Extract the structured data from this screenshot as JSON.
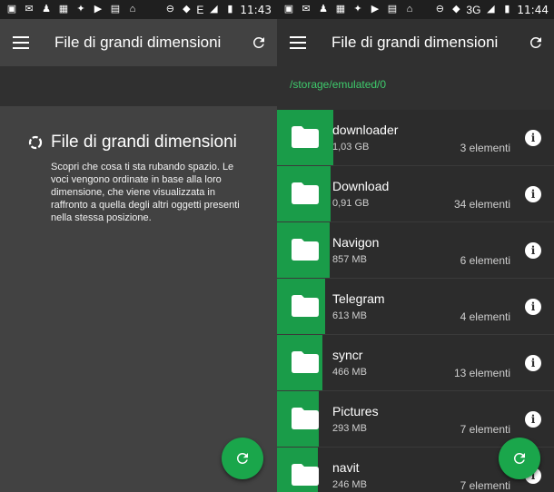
{
  "left": {
    "status": {
      "time": "11:43",
      "network": "E"
    },
    "appbar": {
      "title": "File di grandi dimensioni"
    },
    "feature": {
      "title": "File di grandi dimensioni",
      "description": "Scopri che cosa ti sta rubando spazio. Le voci vengono ordinate in base alla loro dimensione, che viene visualizzata in raffronto a quella degli altri oggetti presenti nella stessa posizione."
    }
  },
  "right": {
    "status": {
      "time": "11:44",
      "network": "3G"
    },
    "appbar": {
      "title": "File di grandi dimensioni"
    },
    "path": "/storage/emulated/0",
    "items": [
      {
        "name": "downloader",
        "size": "1,03 GB",
        "count": "3 elementi",
        "fill": 0.18
      },
      {
        "name": "Download",
        "size": "0,91 GB",
        "count": "34 elementi",
        "fill": 0.16
      },
      {
        "name": "Navigon",
        "size": "857 MB",
        "count": "6 elementi",
        "fill": 0.15
      },
      {
        "name": "Telegram",
        "size": "613 MB",
        "count": "4 elementi",
        "fill": 0.11
      },
      {
        "name": "syncr",
        "size": "466 MB",
        "count": "13 elementi",
        "fill": 0.08
      },
      {
        "name": "Pictures",
        "size": "293 MB",
        "count": "7 elementi",
        "fill": 0.05
      },
      {
        "name": "navit",
        "size": "246 MB",
        "count": "7 elementi",
        "fill": 0.04
      }
    ]
  },
  "colors": {
    "accent": "#1aa64b",
    "bar": "#1a9c49",
    "path": "#3ecb6c"
  }
}
